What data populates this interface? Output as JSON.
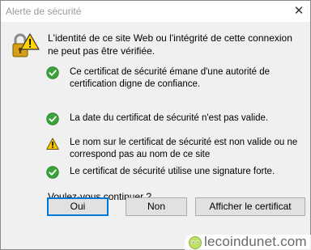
{
  "window": {
    "title": "Alerte de sécurité",
    "close_glyph": "✕"
  },
  "intro": {
    "text": "L'identité de ce site Web ou l'intégrité de cette connexion ne peut pas être vérifiée.",
    "icon": "security-lock-warning-icon"
  },
  "items": [
    {
      "icon": "green-check-icon",
      "text": "Ce certificat de sécurité émane d'une autorité de certification digne de confiance."
    },
    {
      "icon": "green-check-icon",
      "text": "La date du certificat de sécurité n'est pas valide."
    },
    {
      "icon": "yellow-warning-icon",
      "text": "Le nom sur le certificat de sécurité est non valide ou ne correspond pas au nom de ce site"
    },
    {
      "icon": "green-check-icon",
      "text": "Le certificat de sécurité utilise une signature forte."
    }
  ],
  "question": "Voulez-vous continuer ?",
  "buttons": {
    "yes": "Oui",
    "no": "Non",
    "view_certificate": "Afficher le certificat"
  },
  "watermark": {
    "text": "lecoindunet.com"
  },
  "colors": {
    "check_green": "#3aa33a",
    "warning_yellow": "#f5c400",
    "focus_blue": "#0078d7"
  }
}
